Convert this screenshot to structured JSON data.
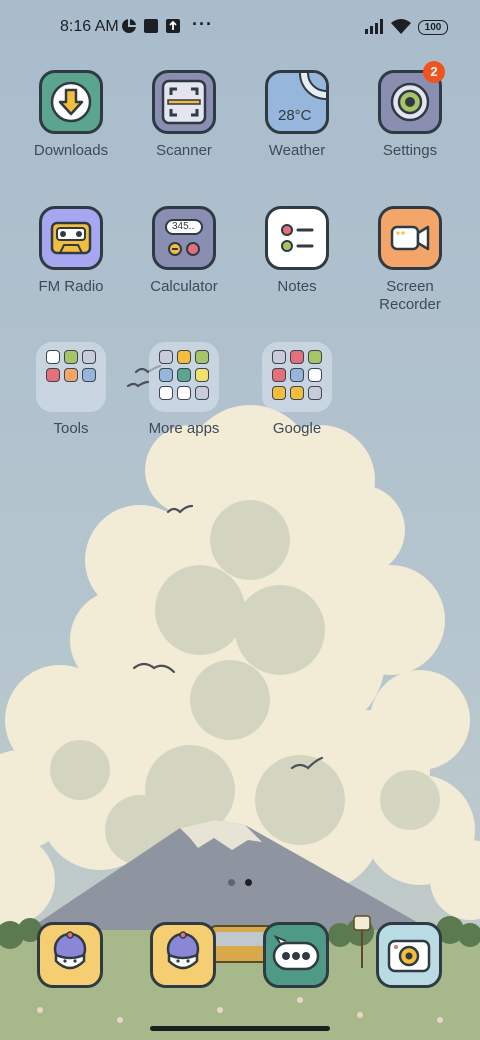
{
  "status_bar": {
    "time": "8:16 AM",
    "overflow": "···",
    "battery": "100",
    "icons": [
      "quad-circle-icon",
      "square-icon",
      "upload-box-icon",
      "signal-icon",
      "wifi-icon",
      "battery-icon"
    ]
  },
  "apps": {
    "downloads": {
      "label": "Downloads",
      "icon": "download-arrow-icon",
      "color": "#5ba48d"
    },
    "scanner": {
      "label": "Scanner",
      "icon": "scan-frame-icon",
      "color": "#8a8fb2"
    },
    "weather": {
      "label": "Weather",
      "icon": "weather-icon",
      "temp": "28°C",
      "color": "#96b6dc"
    },
    "settings": {
      "label": "Settings",
      "icon": "gear-icon",
      "badge": "2",
      "color": "#8a8fb2"
    },
    "fm_radio": {
      "label": "FM Radio",
      "icon": "cassette-icon",
      "color": "#a7a6f0"
    },
    "calculator": {
      "label": "Calculator",
      "icon": "calculator-icon",
      "display": "345..",
      "color": "#8a8fb2"
    },
    "notes": {
      "label": "Notes",
      "icon": "checklist-icon",
      "color": "#ffffff"
    },
    "screen_recorder": {
      "label": "Screen\nRecorder",
      "line1": "Screen",
      "line2": "Recorder",
      "icon": "video-camera-icon",
      "color": "#f4a66a"
    }
  },
  "folders": {
    "tools": {
      "label": "Tools"
    },
    "more_apps": {
      "label": "More apps"
    },
    "google": {
      "label": "Google"
    }
  },
  "dock": [
    {
      "icon": "cupcake-icon",
      "color": "#f5ce71"
    },
    {
      "icon": "cupcake-icon",
      "color": "#f5ce71"
    },
    {
      "icon": "chat-bubble-icon",
      "color": "#4f9a86"
    },
    {
      "icon": "camera-icon",
      "color": "#b9dbe4"
    }
  ],
  "pager": {
    "pages": 2,
    "current": 2
  }
}
